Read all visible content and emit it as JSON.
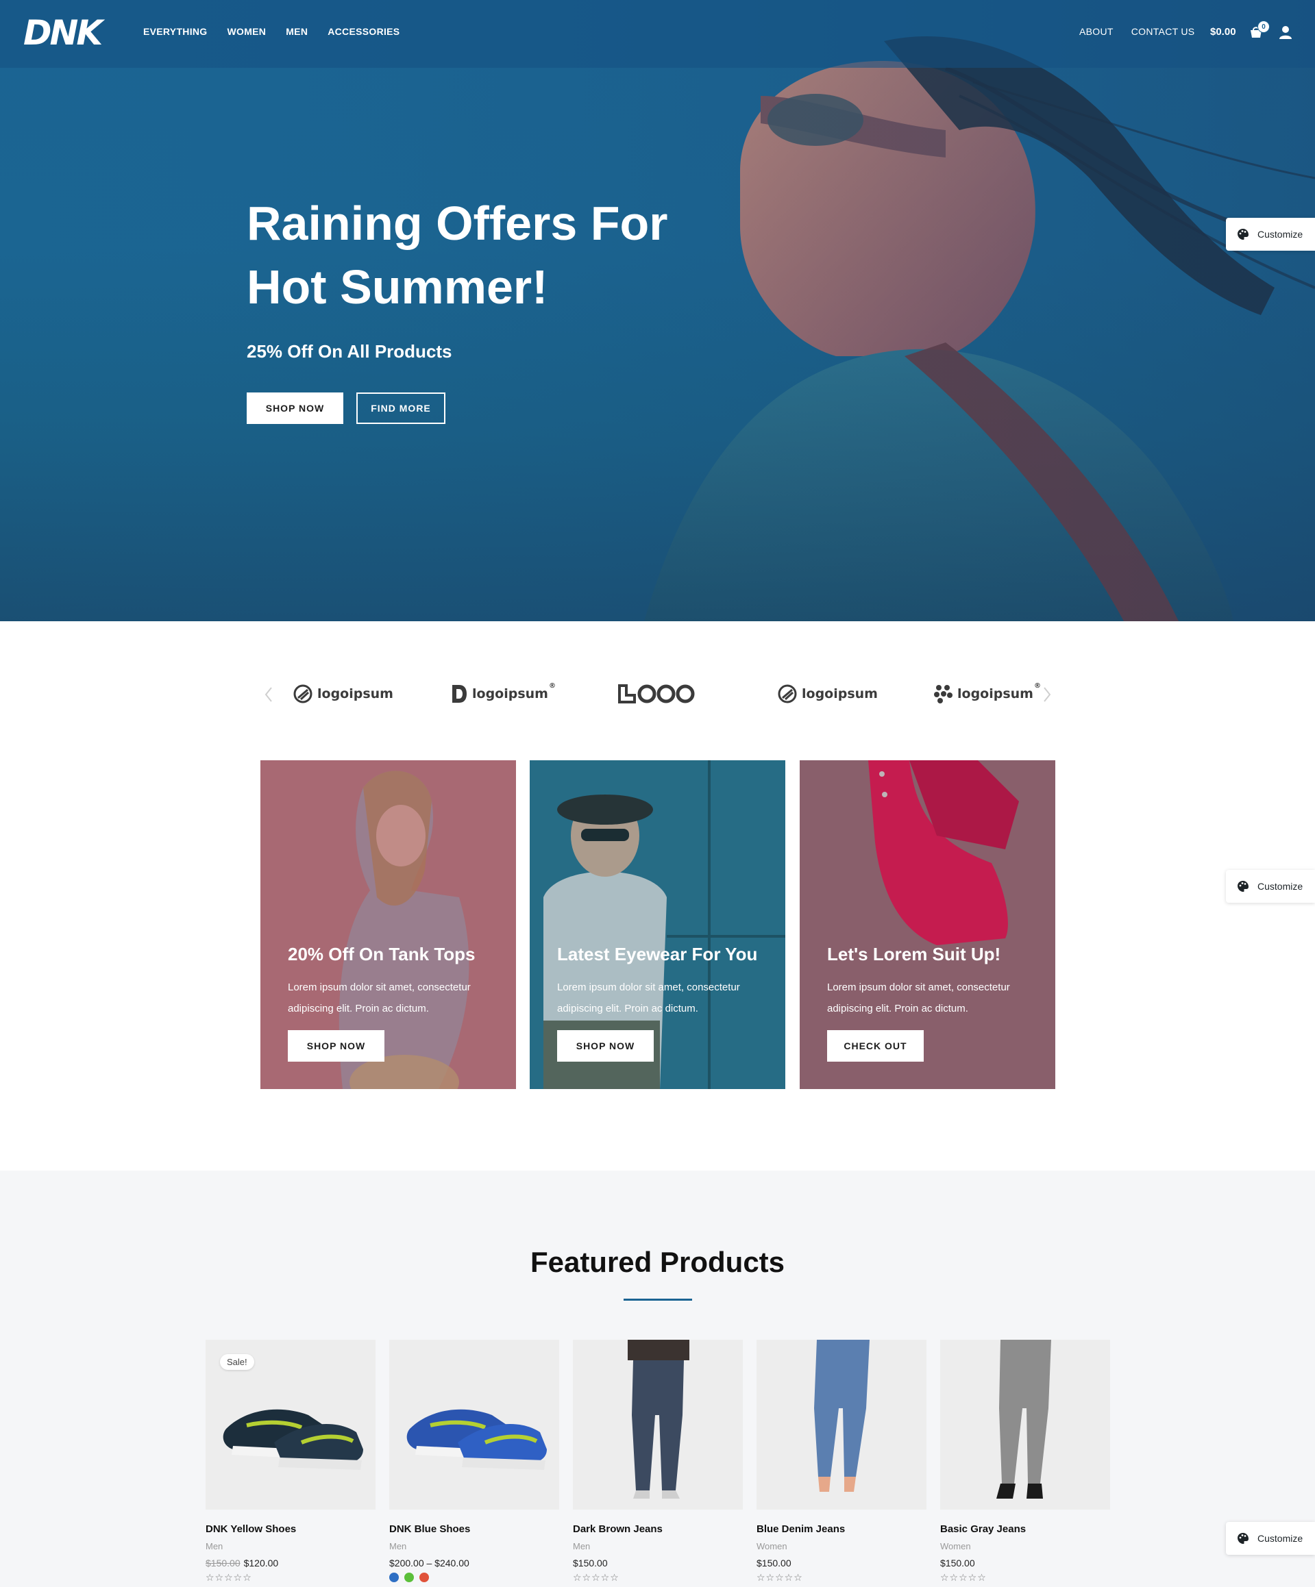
{
  "header": {
    "logo_text": "DNK",
    "nav_left": [
      "EVERYTHING",
      "WOMEN",
      "MEN",
      "ACCESSORIES"
    ],
    "nav_right": [
      "ABOUT",
      "CONTACT US"
    ],
    "cart_total": "$0.00",
    "cart_count": "0"
  },
  "hero": {
    "title": "Raining Offers For Hot Summer!",
    "subtitle": "25% Off On All Products",
    "primary_button": "SHOP NOW",
    "secondary_button": "FIND MORE"
  },
  "customize_label": "Customize",
  "brands": [
    {
      "label": "logoipsum",
      "icon": "circle-slash-logo-icon"
    },
    {
      "label": "logoipsum",
      "icon": "d-shape-logo-icon",
      "mark": "®"
    },
    {
      "label": "OOO",
      "icon": "logo-wordmark-icon"
    },
    {
      "label": "logoipsum",
      "icon": "circle-slash-logo-icon"
    },
    {
      "label": "logoipsum",
      "icon": "dots-cluster-logo-icon",
      "mark": "®"
    }
  ],
  "promos": [
    {
      "title": "20% Off On Tank Tops",
      "text": "Lorem ipsum dolor sit amet, consectetur adipiscing elit. Proin ac dictum.",
      "button": "SHOP NOW",
      "tint": "#9a5a6a"
    },
    {
      "title": "Latest Eyewear For You",
      "text": "Lorem ipsum dolor sit amet, consectetur adipiscing elit. Proin ac dictum.",
      "button": "SHOP NOW",
      "tint": "#2b6478"
    },
    {
      "title": "Let's Lorem Suit Up!",
      "text": "Lorem ipsum dolor sit amet, consectetur adipiscing elit. Proin ac dictum.",
      "button": "CHECK OUT",
      "tint": "#8a5a6a"
    }
  ],
  "featured": {
    "title": "Featured Products",
    "products": [
      {
        "name": "DNK Yellow Shoes",
        "category": "Men",
        "old_price": "$150.00",
        "price": "$120.00",
        "sale": "Sale!",
        "rating": "☆☆☆☆☆"
      },
      {
        "name": "DNK Blue Shoes",
        "category": "Men",
        "price": "$200.00 – $240.00",
        "rating": "",
        "swatches": [
          "#2e6fc4",
          "#5bbf3a",
          "#e0523a"
        ]
      },
      {
        "name": "Dark Brown Jeans",
        "category": "Men",
        "price": "$150.00",
        "rating": "☆☆☆☆☆"
      },
      {
        "name": "Blue Denim Jeans",
        "category": "Women",
        "price": "$150.00",
        "rating": "☆☆☆☆☆"
      },
      {
        "name": "Basic Gray Jeans",
        "category": "Women",
        "price": "$150.00",
        "rating": "☆☆☆☆☆"
      }
    ]
  },
  "colors": {
    "brand_blue": "#1b6493",
    "white": "#ffffff"
  }
}
